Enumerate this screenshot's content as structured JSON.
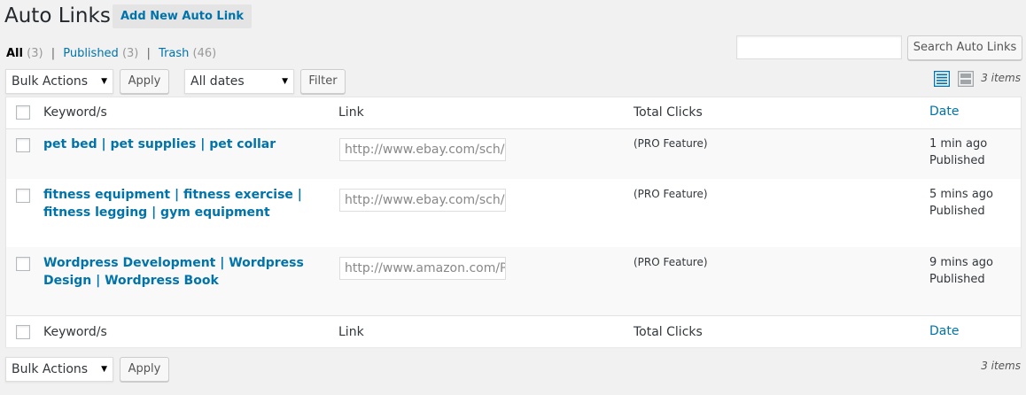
{
  "header": {
    "title": "Auto Links",
    "add_new_label": "Add New Auto Link"
  },
  "filters": {
    "all_label": "All",
    "all_count": "(3)",
    "published_label": "Published",
    "published_count": "(3)",
    "trash_label": "Trash",
    "trash_count": "(46)",
    "separator": "|"
  },
  "search": {
    "input_value": "",
    "button_label": "Search Auto Links"
  },
  "top_nav": {
    "bulk_actions_selected": "Bulk Actions",
    "apply_label": "Apply",
    "dates_selected": "All dates",
    "filter_label": "Filter",
    "items_count": "3 items"
  },
  "table": {
    "columns": {
      "keywords": "Keyword/s",
      "link": "Link",
      "clicks": "Total Clicks",
      "date": "Date"
    },
    "rows": [
      {
        "keywords": "pet bed | pet supplies | pet collar",
        "link": "http://www.ebay.com/sch/i",
        "clicks": "(PRO Feature)",
        "date": "1 min ago",
        "status": "Published"
      },
      {
        "keywords": "fitness equipment | fitness exercise | fitness legging | gym equipment",
        "link": "http://www.ebay.com/sch/i",
        "clicks": "(PRO Feature)",
        "date": "5 mins ago",
        "status": "Published"
      },
      {
        "keywords": "Wordpress Development | Wordpress Design | Wordpress Book",
        "link": "http://www.amazon.com/Pr",
        "clicks": "(PRO Feature)",
        "date": "9 mins ago",
        "status": "Published"
      }
    ]
  },
  "bottom_nav": {
    "bulk_actions_selected": "Bulk Actions",
    "apply_label": "Apply",
    "items_count": "3 items"
  },
  "icons": {
    "list_view": "list-view-icon",
    "excerpt_view": "excerpt-view-icon",
    "dropdown_arrow": "▼"
  },
  "colors": {
    "link": "#0073aa",
    "list_view_active": "#0073aa",
    "excerpt_view_inactive": "#a0a5aa"
  }
}
